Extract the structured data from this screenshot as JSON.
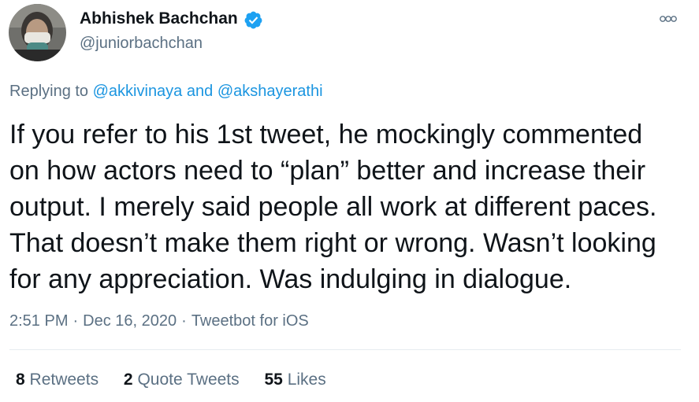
{
  "author": {
    "display_name": "Abhishek Bachchan",
    "handle": "@juniorbachchan",
    "verified": true,
    "verified_color": "#1da1f2",
    "avatar_icon": "profile-photo"
  },
  "reply": {
    "prefix": "Replying to",
    "mention_1": "@akkivinaya",
    "connector": "and",
    "mention_2": "@akshayerathi"
  },
  "tweet": {
    "lines": [
      "If you refer to his 1st tweet, he mockingly commented",
      "on how actors need to “plan” better and increase their",
      "output. I merely said people all work at different paces.",
      "That doesn’t make them right or wrong. Wasn’t looking",
      "for any appreciation. Was indulging in dialogue."
    ]
  },
  "meta": {
    "time": "2:51 PM",
    "separator": "·",
    "date": "Dec 16, 2020",
    "source": "Tweetbot for iOS"
  },
  "stats": {
    "retweets": {
      "count": "8",
      "label": "Retweets"
    },
    "quotes": {
      "count": "2",
      "label": "Quote Tweets"
    },
    "likes": {
      "count": "55",
      "label": "Likes"
    }
  },
  "colors": {
    "text": "#0f1419",
    "secondary": "#5b7083",
    "link": "#1b95e0",
    "divider": "#e6ecf0"
  },
  "icons": {
    "more": "more-horizontal-icon",
    "verified": "verified-badge-icon"
  }
}
